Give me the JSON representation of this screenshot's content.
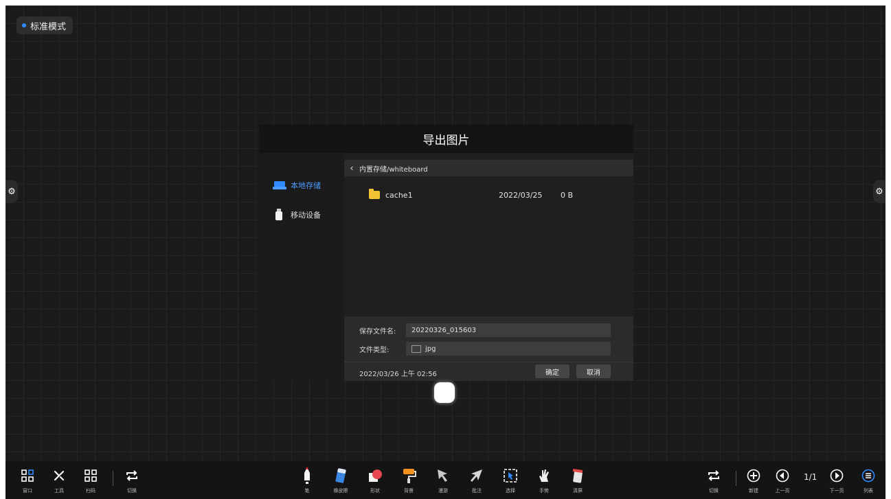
{
  "mode": {
    "label": "标准模式"
  },
  "side": {
    "left_icon": "gear-icon",
    "right_icon": "gear-icon"
  },
  "dialog": {
    "title": "导出图片",
    "locations": [
      {
        "label": "本地存储",
        "icon": "drive-icon",
        "selected": true
      },
      {
        "label": "移动设备",
        "icon": "usb-icon",
        "selected": false
      }
    ],
    "path": "内置存储/whiteboard",
    "files": [
      {
        "name": "cache1",
        "date": "2022/03/25",
        "size": "0 B"
      }
    ],
    "filename_label": "保存文件名:",
    "filename_value": "20220326_015603",
    "filetype_label": "文件类型:",
    "filetype_value": "jpg",
    "timestamp": "2022/03/26 上午 02:56",
    "ok_label": "确定",
    "cancel_label": "取消"
  },
  "toolbar": {
    "left": [
      {
        "label": "窗口",
        "icon": "windows-grid-icon"
      },
      {
        "label": "工具",
        "icon": "tools-icon"
      },
      {
        "label": "扫码",
        "icon": "qrcode-icon"
      },
      {
        "label": "切换",
        "icon": "switch-icon"
      }
    ],
    "center": [
      {
        "label": "笔",
        "icon": "pen-icon"
      },
      {
        "label": "橡皮擦",
        "icon": "eraser-icon"
      },
      {
        "label": "形状",
        "icon": "shape-icon"
      },
      {
        "label": "背景",
        "icon": "paint-roller-icon"
      },
      {
        "label": "漫游",
        "icon": "roam-cursor-icon"
      },
      {
        "label": "批注",
        "icon": "annotate-arrow-icon"
      },
      {
        "label": "选择",
        "icon": "select-icon"
      },
      {
        "label": "手势",
        "icon": "hand-icon"
      },
      {
        "label": "清屏",
        "icon": "clear-icon"
      }
    ],
    "right": [
      {
        "label": "切换",
        "icon": "switch-icon"
      },
      {
        "label": "新建",
        "icon": "add-page-icon"
      },
      {
        "label": "上一页",
        "icon": "prev-page-icon"
      },
      {
        "label": "下一页",
        "icon": "next-page-icon"
      },
      {
        "label": "列表",
        "icon": "list-icon"
      }
    ],
    "page": "1/1"
  },
  "colors": {
    "accent": "#2f8bff",
    "folder": "#f3c234",
    "background": "#1b1b1b"
  }
}
